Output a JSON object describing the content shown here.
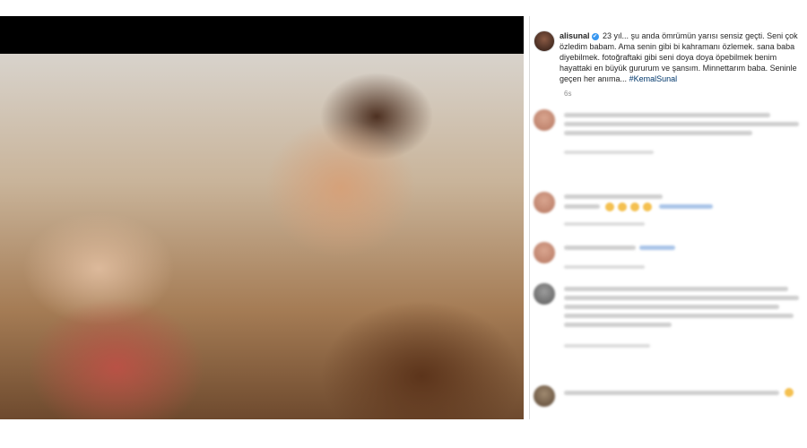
{
  "post": {
    "username": "alisunal",
    "verified_badge": "✔",
    "caption_text": "23 yıl... şu anda ömrümün yarısı sensiz geçti. Seni çok özledim babam. Ama senin gibi bi kahramanı özlemek. sana baba diyebilmek. fotoğraftaki gibi seni doya doya öpebilmek benim hayattaki en büyük gururum ve şansım. Minnettarım baba. Seninle geçen her anıma...",
    "hashtag": "#KemalSunal",
    "time": "6s"
  },
  "icons": {
    "verified": "verified-badge-icon",
    "avatar": "profile-avatar"
  },
  "colors": {
    "text": "#262626",
    "muted": "#8e8e8e",
    "verified": "#3897f0",
    "hashtag": "#00376b",
    "divider": "#dbdbdb"
  }
}
